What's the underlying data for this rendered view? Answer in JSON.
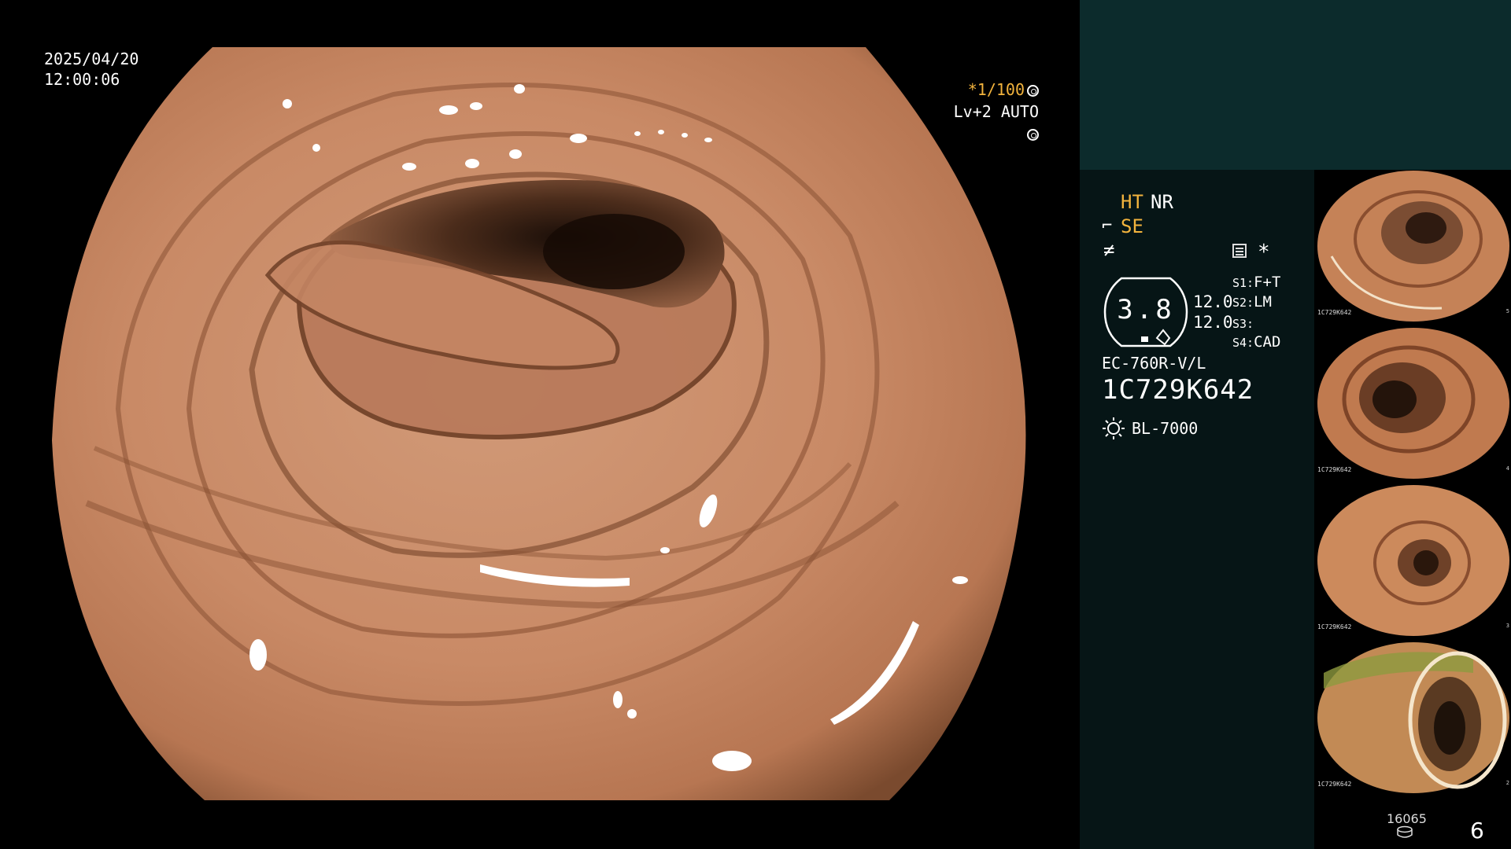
{
  "overlay": {
    "date": "2025/04/20",
    "time": "12:00:06",
    "shutter": "*1/100",
    "iris": "Lv+2 AUTO"
  },
  "panel": {
    "mode_ht": "HT",
    "mode_nr": "NR",
    "mode_se": "SE",
    "asterisk": "*",
    "gauge_value": "3.8",
    "gain_1": "12.0",
    "gain_2": "12.0",
    "s1_label": "S1:",
    "s1_value": "F+T",
    "s2_label": "S2:",
    "s2_value": "LM",
    "s3_label": "S3:",
    "s3_value": "",
    "s4_label": "S4:",
    "s4_value": "CAD",
    "scope_model": "EC-760R-V/L",
    "scope_serial": "1C729K642",
    "light_source": "BL-7000"
  },
  "thumbnails": [
    {
      "serial": "1C729K642",
      "index": "5"
    },
    {
      "serial": "1C729K642",
      "index": "4"
    },
    {
      "serial": "1C729K642",
      "index": "3"
    },
    {
      "serial": "1C729K642",
      "index": "2"
    }
  ],
  "footer": {
    "capture_count": "16065",
    "page_number": "6"
  },
  "colors": {
    "panel_top": "#0c2b2c",
    "panel_body": "#061516",
    "highlight": "#f2b33d",
    "tissue": "#c8896a"
  },
  "icons": [
    "ring-icon",
    "se-icon",
    "slash-icon",
    "menu-icon",
    "asterisk-icon",
    "light-bulb-icon",
    "disk-icon"
  ]
}
